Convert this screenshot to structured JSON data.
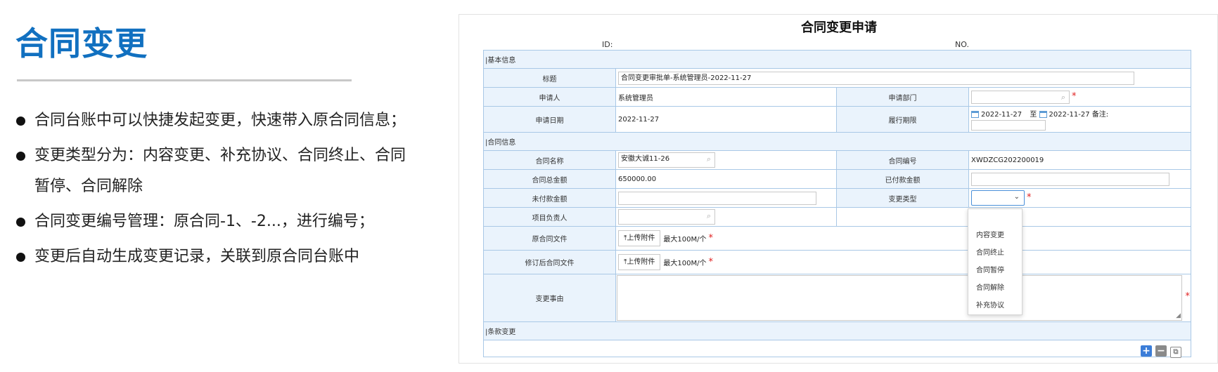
{
  "slide": {
    "title": "合同变更",
    "bullets": [
      "合同台账中可以快捷发起变更，快速带入原合同信息；",
      "变更类型分为：内容变更、补充协议、合同终止、合同暂停、合同解除",
      "合同变更编号管理：原合同-1、-2...，进行编号；",
      "变更后自动生成变更记录，关联到原合同台账中"
    ]
  },
  "form": {
    "title": "合同变更申请",
    "id_label": "ID:",
    "no_label": "NO.",
    "sections": {
      "basic": "|基本信息",
      "contract": "|合同信息",
      "clause": "|条款变更"
    },
    "labels": {
      "title": "标题",
      "applicant": "申请人",
      "apply_dept": "申请部门",
      "apply_date": "申请日期",
      "perform_period": "履行期限",
      "contract_name": "合同名称",
      "contract_no": "合同编号",
      "total_amount": "合同总金额",
      "paid_amount": "已付款金额",
      "unpaid_amount": "未付款金额",
      "change_type": "变更类型",
      "project_owner": "项目负责人",
      "original_file": "原合同文件",
      "revised_file": "修订后合同文件",
      "change_reason": "变更事由"
    },
    "values": {
      "title": "合同变更审批单-系统管理员-2022-11-27",
      "applicant": "系统管理员",
      "apply_date": "2022-11-27",
      "period_start": "2022-11-27",
      "period_to": "至",
      "period_end": "2022-11-27",
      "period_note": "备注:",
      "contract_name": "安徽大诚11-26",
      "contract_no": "XWDZCG202200019",
      "total_amount": "650000.00"
    },
    "upload": {
      "button": "上传附件",
      "note": "最大100M/个"
    },
    "required_mark": "*",
    "change_type_options": [
      "内容变更",
      "合同终止",
      "合同暂停",
      "合同解除",
      "补充协议"
    ],
    "icons": {
      "search": "search-icon",
      "calendar": "calendar-icon",
      "upload": "upload-icon",
      "add": "add-icon",
      "remove": "remove-icon",
      "copy": "copy-icon"
    },
    "colors": {
      "accent": "#1170c0",
      "label_bg": "#eaf3fc",
      "border": "#a9c8e6",
      "required": "#e02020",
      "link": "#1a4fa0"
    }
  }
}
